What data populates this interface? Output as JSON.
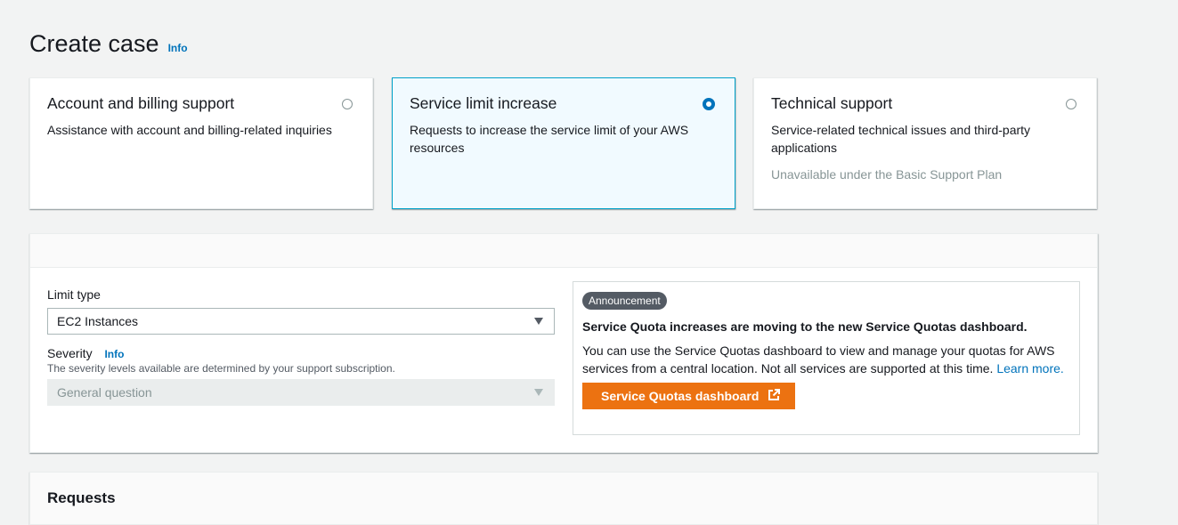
{
  "header": {
    "title": "Create case",
    "info_label": "Info"
  },
  "case_types": [
    {
      "title": "Account and billing support",
      "description": "Assistance with account and billing-related inquiries",
      "selected": false
    },
    {
      "title": "Service limit increase",
      "description": "Requests to increase the service limit of your AWS resources",
      "selected": true
    },
    {
      "title": "Technical support",
      "description": "Service-related technical issues and third-party applications",
      "note": "Unavailable under the Basic Support Plan",
      "selected": false
    }
  ],
  "form": {
    "limit_type_label": "Limit type",
    "limit_type_value": "EC2 Instances",
    "severity_label": "Severity",
    "severity_info": "Info",
    "severity_description": "The severity levels available are determined by your support subscription.",
    "severity_value": "General question"
  },
  "announcement": {
    "badge": "Announcement",
    "title": "Service Quota increases are moving to the new Service Quotas dashboard.",
    "body": "You can use the Service Quotas dashboard to view and manage your quotas for AWS services from a central location. Not all services are supported at this time.",
    "link_label": "Learn more.",
    "button_label": "Service Quotas dashboard"
  },
  "requests": {
    "title": "Requests"
  },
  "colors": {
    "accent": "#0073bb",
    "button": "#ec7211",
    "selected_border": "#00a1c9",
    "selected_bg": "#f1faff"
  }
}
